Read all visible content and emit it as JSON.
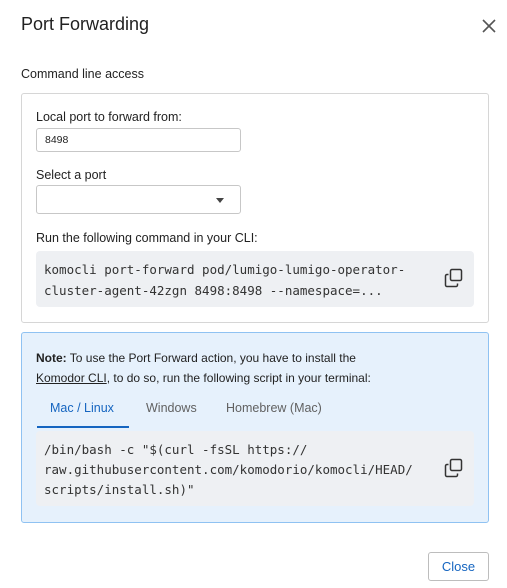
{
  "dialog": {
    "title": "Port Forwarding",
    "close_icon": "close-icon"
  },
  "command_line": {
    "section_label": "Command line access",
    "local_port_label": "Local port to forward from:",
    "local_port_value": "8498",
    "select_port_label": "Select a port",
    "select_port_value": "",
    "run_label": "Run the following command in your CLI:",
    "command_lines": [
      "komocli port-forward pod/lumigo-lumigo-operator-",
      "cluster-agent-42zgn 8498:8498 --namespace=..."
    ],
    "copy_icon": "copy-icon"
  },
  "note": {
    "bold_prefix": "Note:",
    "line1_rest": " To use the Port Forward action, you have to install the",
    "link_text": "Komodor CLI",
    "line2_rest": ", to do so, run the following script in your terminal:",
    "tabs": [
      {
        "label": "Mac / Linux",
        "active": true
      },
      {
        "label": "Windows",
        "active": false
      },
      {
        "label": "Homebrew (Mac)",
        "active": false
      }
    ],
    "script_lines": [
      "/bin/bash -c \"$(curl -fsSL https://",
      "raw.githubusercontent.com/komodorio/komocli/HEAD/",
      "scripts/install.sh)\""
    ],
    "copy_icon": "copy-icon"
  },
  "footer": {
    "close_label": "Close"
  },
  "colors": {
    "accent": "#1565c0",
    "note_background": "#e6f1fc",
    "note_border": "#8fc2f2",
    "code_background": "#eef0f3"
  }
}
